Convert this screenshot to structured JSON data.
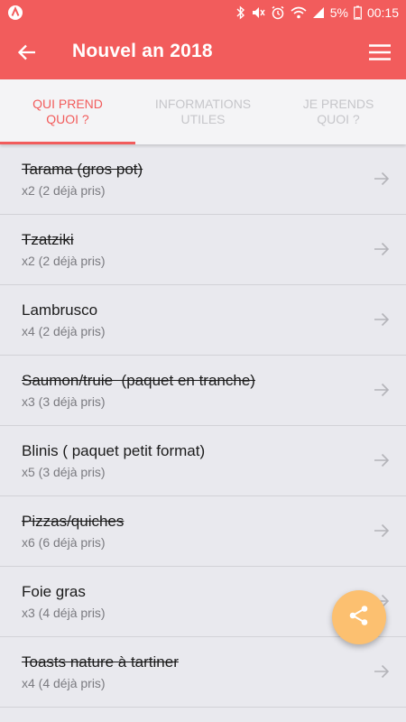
{
  "status_bar": {
    "battery": "5%",
    "time": "00:15",
    "icons": [
      "bluetooth-icon",
      "mute-icon",
      "alarm-icon",
      "wifi-icon",
      "signal-icon",
      "battery-icon"
    ]
  },
  "app_bar": {
    "title": "Nouvel an 2018",
    "back_icon": "arrow-left-icon",
    "menu_icon": "hamburger-menu-icon",
    "color": "#f25c5c"
  },
  "tabs": [
    {
      "label": "QUI PREND\nQUOI ?",
      "active": true
    },
    {
      "label": "INFORMATIONS\nUTILES",
      "active": false
    },
    {
      "label": "JE PRENDS\nQUOI ?",
      "active": false
    }
  ],
  "items": [
    {
      "name": "Tarama (gros pot)",
      "qty": "x2 (2 déjà pris)",
      "struck": true
    },
    {
      "name": "Tzatziki",
      "qty": "x2 (2 déjà pris)",
      "struck": true
    },
    {
      "name": "Lambrusco",
      "qty": "x4 (2 déjà pris)",
      "struck": false
    },
    {
      "name": "Saumon/truie  (paquet en tranche)",
      "qty": "x3 (3 déjà pris)",
      "struck": true
    },
    {
      "name": "Blinis ( paquet petit format)",
      "qty": "x5 (3 déjà pris)",
      "struck": false
    },
    {
      "name": "Pizzas/quiches",
      "qty": "x6 (6 déjà pris)",
      "struck": true
    },
    {
      "name": "Foie gras",
      "qty": "x3 (4 déjà pris)",
      "struck": false
    },
    {
      "name": "Toasts nature à tartiner",
      "qty": "x4 (4 déjà pris)",
      "struck": true
    }
  ],
  "fab": {
    "icon": "share-icon",
    "color": "#fcc070"
  }
}
